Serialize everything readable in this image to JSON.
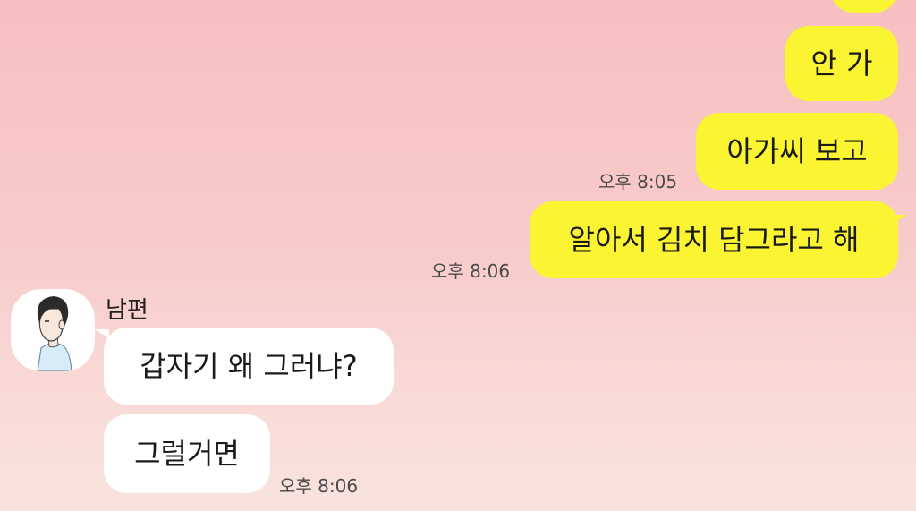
{
  "chat": {
    "outgoing": [
      {
        "text": "안 가",
        "time": ""
      },
      {
        "text": "아가씨 보고",
        "time": "오후 8:05"
      },
      {
        "text": "알아서 김치 담그라고 해",
        "time": "오후 8:06"
      }
    ],
    "incoming": {
      "sender": "남편",
      "avatar_icon": "man-profile-icon",
      "messages": [
        {
          "text": "갑자기 왜 그러냐?"
        },
        {
          "text": "그럴거면",
          "time": "오후 8:06"
        }
      ]
    }
  },
  "colors": {
    "my_bubble": "#fbf433",
    "their_bubble": "#ffffff",
    "background_top": "#f7bfc0",
    "background_bottom": "#f9e3de"
  }
}
